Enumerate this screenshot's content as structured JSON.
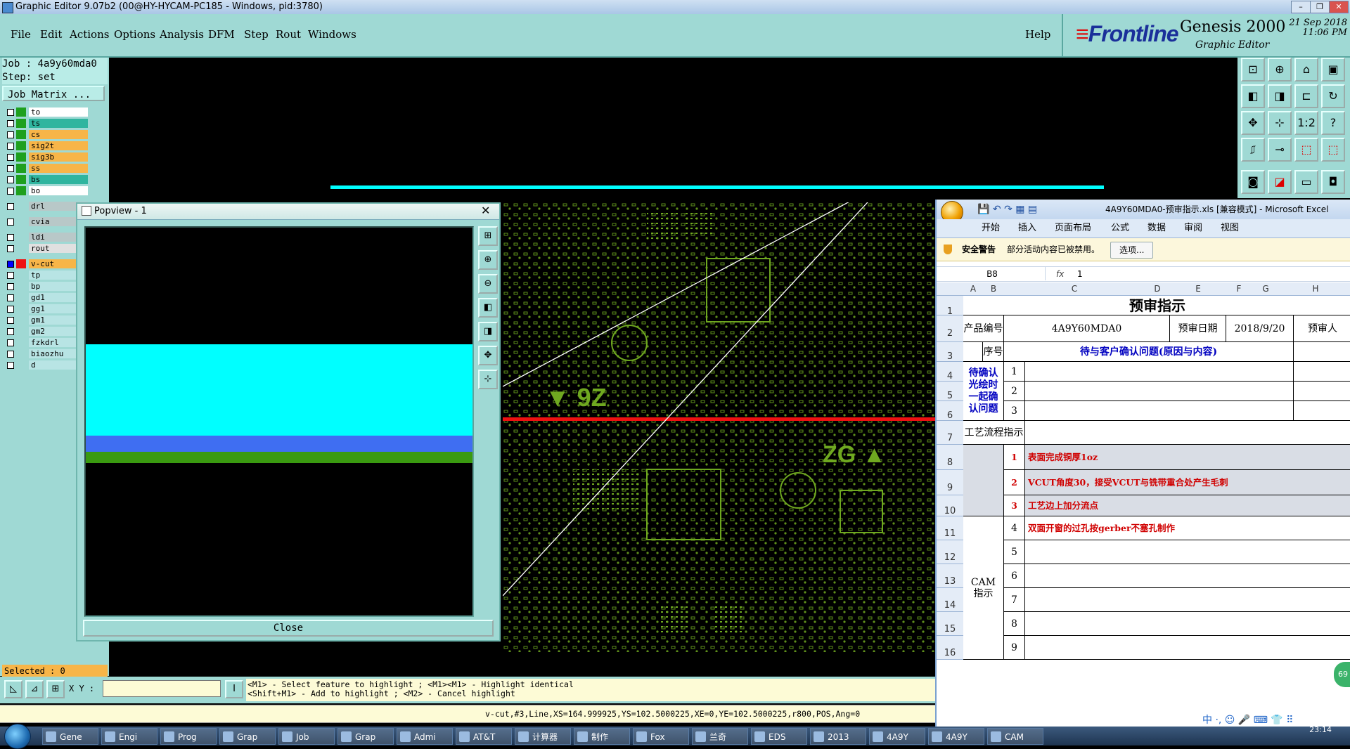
{
  "window": {
    "title": "Graphic Editor 9.07b2 (00@HY-HYCAM-PC185 - Windows, pid:3780)",
    "controls": [
      "–",
      "❐",
      "✕"
    ]
  },
  "menu": [
    "File",
    "Edit",
    "Actions",
    "Options",
    "Analysis",
    "DFM",
    "Step",
    "Rout",
    "Windows"
  ],
  "help": "Help",
  "brand": {
    "logo": "Frontline",
    "product": "Genesis 2000",
    "subtitle": "Graphic Editor",
    "date": "21 Sep 2018",
    "time": "11:06 PM"
  },
  "job": {
    "job_label": "Job : 4a9y60mda0",
    "step_label": "Step: set",
    "matrix_button": "Job Matrix ..."
  },
  "layers": [
    {
      "name": "to",
      "color": "#ffffff",
      "swatch": "#1ea01e",
      "selected": false
    },
    {
      "name": "ts",
      "color": "#2fb59f",
      "swatch": "#1ea01e",
      "selected": false
    },
    {
      "name": "cs",
      "color": "#f7b548",
      "swatch": "#1ea01e",
      "selected": false
    },
    {
      "name": "sig2t",
      "color": "#f7b548",
      "swatch": "#1ea01e",
      "selected": false
    },
    {
      "name": "sig3b",
      "color": "#f7b548",
      "swatch": "#1ea01e",
      "selected": false
    },
    {
      "name": "ss",
      "color": "#f7b548",
      "swatch": "#1ea01e",
      "selected": false
    },
    {
      "name": "bs",
      "color": "#2fb59f",
      "swatch": "#1ea01e",
      "selected": false
    },
    {
      "name": "bo",
      "color": "#ffffff",
      "swatch": "#1ea01e",
      "selected": false
    },
    {
      "name": "drl",
      "color": "#b8c8c8",
      "swatch": "#9fd9d4",
      "selected": false,
      "gap": true
    },
    {
      "name": "cvia",
      "color": "#b8c8c8",
      "swatch": "#9fd9d4",
      "selected": false,
      "gap": true
    },
    {
      "name": "ldi",
      "color": "#b8c8c8",
      "swatch": "#9fd9d4",
      "selected": false,
      "gap": true
    },
    {
      "name": "rout",
      "color": "#e0e0e0",
      "swatch": "#9fd9d4",
      "selected": false
    },
    {
      "name": "v-cut",
      "color": "#f7b548",
      "swatch": "#ee1111",
      "selected": true,
      "gap": true
    },
    {
      "name": "tp",
      "color": "#b8e4e4",
      "swatch": "#9fd9d4",
      "selected": false
    },
    {
      "name": "bp",
      "color": "#b8e4e4",
      "swatch": "#9fd9d4",
      "selected": false
    },
    {
      "name": "gd1",
      "color": "#b8e4e4",
      "swatch": "#9fd9d4",
      "selected": false
    },
    {
      "name": "gg1",
      "color": "#b8e4e4",
      "swatch": "#9fd9d4",
      "selected": false
    },
    {
      "name": "gm1",
      "color": "#b8e4e4",
      "swatch": "#9fd9d4",
      "selected": false
    },
    {
      "name": "gm2",
      "color": "#b8e4e4",
      "swatch": "#9fd9d4",
      "selected": false
    },
    {
      "name": "fzkdrl",
      "color": "#b8e4e4",
      "swatch": "#9fd9d4",
      "selected": false
    },
    {
      "name": "biaozhu",
      "color": "#b8e4e4",
      "swatch": "#9fd9d4",
      "selected": false
    },
    {
      "name": "d",
      "color": "#b8e4e4",
      "swatch": "#9fd9d4",
      "selected": false
    }
  ],
  "selected_label": "Selected : 0",
  "popview": {
    "title": "Popview - 1",
    "close_label": "Close",
    "close_x": "✕"
  },
  "bottom": {
    "xy_label": "X Y :",
    "xy_value": "",
    "help_line1": "<M1> - Select feature to highlight ; <M1><M1> - Highlight identical",
    "help_line2": "<Shift+M1> - Add to highlight ; <M2> - Cancel highlight",
    "feature_info": "v-cut,#3,Line,XS=164.999925,YS=102.5000225,XE=0,YE=102.5000225,r800,POS,Ang=0"
  },
  "excel": {
    "title": "4A9Y60MDA0-预审指示.xls  [兼容模式] - Microsoft Excel",
    "ribbon_tabs": [
      "开始",
      "插入",
      "页面布局",
      "公式",
      "数据",
      "审阅",
      "视图"
    ],
    "security_warning": "安全警告",
    "security_text": "部分活动内容已被禁用。",
    "options_button": "选项...",
    "name_box": "B8",
    "fx": "fx",
    "formula_value": "1",
    "columns": [
      "A",
      "B",
      "C",
      "D",
      "E",
      "F",
      "G",
      "H"
    ],
    "row_numbers": [
      "1",
      "2",
      "3",
      "4",
      "5",
      "6",
      "7",
      "8",
      "9",
      "10",
      "11",
      "12",
      "13",
      "14",
      "15",
      "16"
    ],
    "sheet_title": "预审指示",
    "product_label": "产品编号",
    "product_value": "4A9Y60MDA0",
    "date_label": "预审日期",
    "date_value": "2018/9/20",
    "reviewer_label": "预审人",
    "seq_label": "序号",
    "issues_header": "待与客户确认问题(原因与内容)",
    "confirm_label": "待确认光绘时一起确认问题",
    "issue_nums": [
      "1",
      "2",
      "3"
    ],
    "process_label": "工艺流程指示",
    "process_items": [
      {
        "num": "1",
        "text": "表面完成铜厚1oz"
      },
      {
        "num": "2",
        "text": "VCUT角度30，接受VCUT与铣带重合处产生毛刺"
      },
      {
        "num": "3",
        "text": "工艺边上加分流点"
      }
    ],
    "cam_label": "CAM指示",
    "cam_items": [
      {
        "num": "4",
        "text": "双面开窗的过孔按gerber不塞孔制作"
      },
      {
        "num": "5",
        "text": ""
      },
      {
        "num": "6",
        "text": ""
      },
      {
        "num": "7",
        "text": ""
      },
      {
        "num": "8",
        "text": ""
      },
      {
        "num": "9",
        "text": ""
      }
    ]
  },
  "taskbar": {
    "items": [
      "Gene",
      "Engi",
      "Prog",
      "Grap",
      "Job",
      "Grap",
      "Admi",
      "AT&T",
      "计算器",
      "制作",
      "Fox",
      "兰奇",
      "EDS",
      "2013",
      "4A9Y",
      "4A9Y",
      "CAM"
    ],
    "time": "23:14",
    "ime": "中 ·, ☺ 🎤 ⌨ 👕 ⠿"
  },
  "badge": "69",
  "colors": {
    "panel": "#9fd9d4",
    "cyan": "#00ffff",
    "pcb_green": "#6fa820",
    "vcut_red": "#ee1111"
  }
}
